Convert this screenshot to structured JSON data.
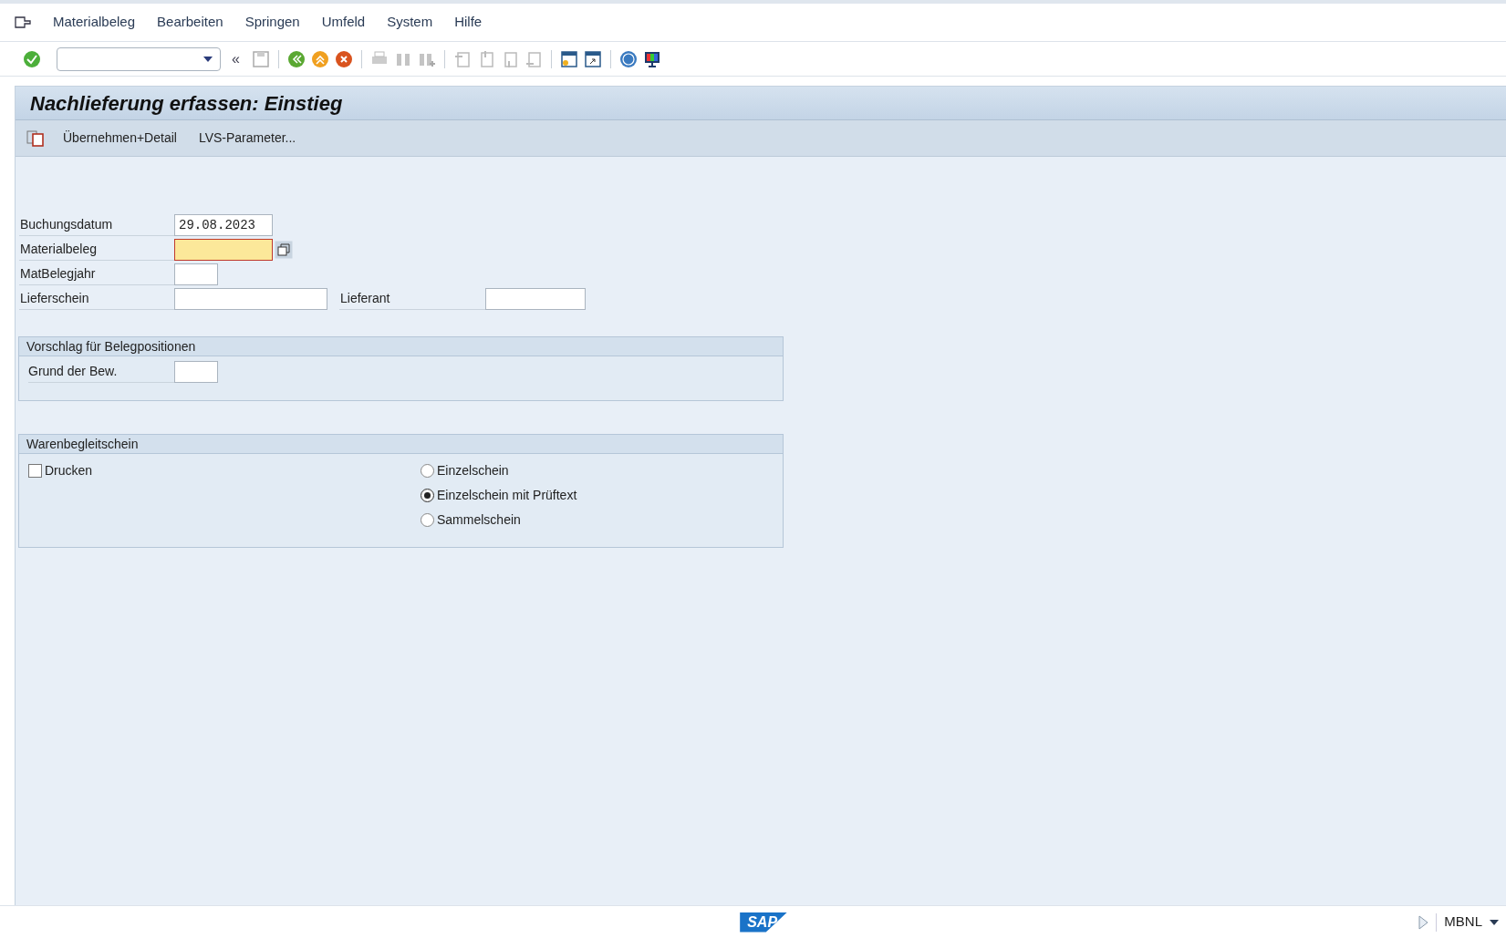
{
  "menu_bar": {
    "items": [
      "Materialbeleg",
      "Bearbeiten",
      "Springen",
      "Umfeld",
      "System",
      "Hilfe"
    ]
  },
  "toolbar": {
    "collapse": "«"
  },
  "title": "Nachlieferung erfassen: Einstieg",
  "app_toolbar": {
    "buttons": [
      "Übernehmen+Detail",
      "LVS-Parameter..."
    ]
  },
  "fields": [
    {
      "label": "Buchungsdatum",
      "value": "29.08.2023",
      "kind": "date",
      "focused": false
    },
    {
      "label": "Materialbeleg",
      "kind": "number",
      "focused": true
    },
    {
      "label": "MatBelegjahr",
      "kind": "year",
      "focused": false
    }
  ],
  "lieferschein": {
    "label": "Lieferschein"
  },
  "lieferant": {
    "label": "Lieferant"
  },
  "group_vorschlag": {
    "title": "Vorschlag für Belegpositionen",
    "field": {
      "label": "Grund der Bew."
    }
  },
  "group_warenbegleitschein": {
    "title": "Warenbegleitschein",
    "checkbox": {
      "label": "Drucken",
      "checked": false
    },
    "radios": [
      {
        "label": "Einzelschein",
        "selected": false
      },
      {
        "label": "Einzelschein mit Prüftext",
        "selected": true
      },
      {
        "label": "Sammelschein",
        "selected": false
      }
    ]
  },
  "status_bar": {
    "logo": "SAP",
    "transaction": "MBNL"
  }
}
